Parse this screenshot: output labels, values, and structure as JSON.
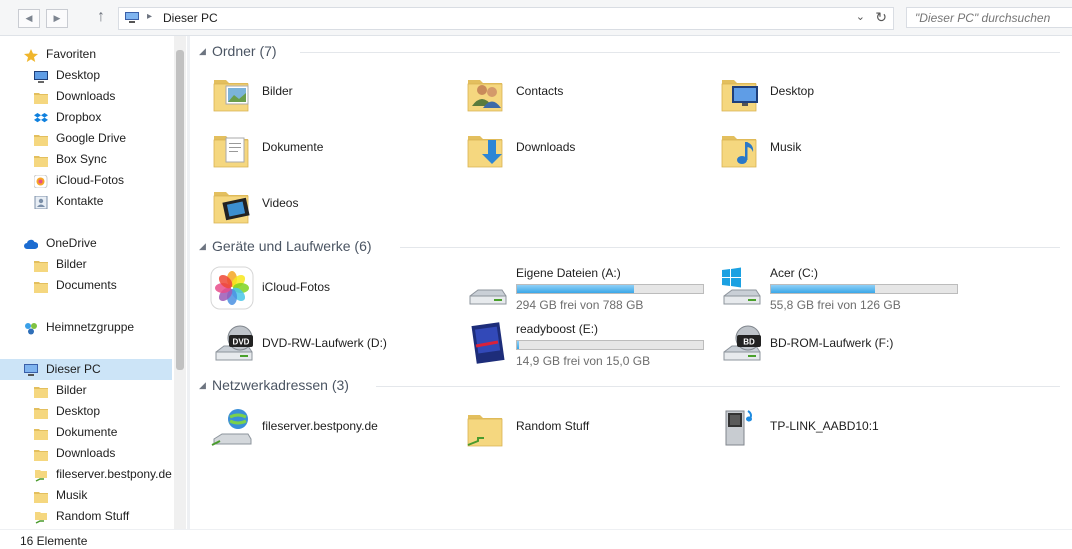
{
  "window": {
    "breadcrumb": "Dieser PC",
    "search_placeholder": "\"Dieser PC\" durchsuchen"
  },
  "nav": [
    {
      "label": "Favoriten",
      "icon": "star-icon",
      "indent": 0
    },
    {
      "label": "Desktop",
      "icon": "desktop-icon",
      "indent": 1
    },
    {
      "label": "Downloads",
      "icon": "folder-icon",
      "indent": 1
    },
    {
      "label": "Dropbox",
      "icon": "dropbox-icon",
      "indent": 1
    },
    {
      "label": "Google Drive",
      "icon": "folder-icon",
      "indent": 1
    },
    {
      "label": "Box Sync",
      "icon": "folder-icon",
      "indent": 1
    },
    {
      "label": "iCloud-Fotos",
      "icon": "photos-icon",
      "indent": 1
    },
    {
      "label": "Kontakte",
      "icon": "contacts-icon",
      "indent": 1
    },
    {
      "label": "OneDrive",
      "icon": "cloud-icon",
      "indent": 0
    },
    {
      "label": "Bilder",
      "icon": "folder-icon",
      "indent": 1
    },
    {
      "label": "Documents",
      "icon": "folder-icon",
      "indent": 1
    },
    {
      "label": "Heimnetzgruppe",
      "icon": "homegroup-icon",
      "indent": 0
    },
    {
      "label": "Dieser PC",
      "icon": "computer-icon",
      "indent": 0,
      "selected": true
    },
    {
      "label": "Bilder",
      "icon": "folder-icon",
      "indent": 1
    },
    {
      "label": "Desktop",
      "icon": "folder-icon",
      "indent": 1
    },
    {
      "label": "Dokumente",
      "icon": "folder-icon",
      "indent": 1
    },
    {
      "label": "Downloads",
      "icon": "folder-icon",
      "indent": 1
    },
    {
      "label": "fileserver.bestpony.de",
      "icon": "network-drive-icon",
      "indent": 1
    },
    {
      "label": "Musik",
      "icon": "folder-icon",
      "indent": 1
    },
    {
      "label": "Random Stuff",
      "icon": "network-drive-icon",
      "indent": 1
    }
  ],
  "groups": {
    "folders": {
      "title": "Ordner (7)",
      "items": [
        {
          "name": "Bilder",
          "icon": "pictures-folder-icon"
        },
        {
          "name": "Contacts",
          "icon": "contacts-folder-icon"
        },
        {
          "name": "Desktop",
          "icon": "desktop-folder-icon"
        },
        {
          "name": "Dokumente",
          "icon": "documents-folder-icon"
        },
        {
          "name": "Downloads",
          "icon": "downloads-folder-icon"
        },
        {
          "name": "Musik",
          "icon": "music-folder-icon"
        },
        {
          "name": "Videos",
          "icon": "videos-folder-icon"
        }
      ]
    },
    "devices": {
      "title": "Geräte und Laufwerke (6)",
      "items": [
        {
          "name": "iCloud-Fotos",
          "icon": "icloud-photos-icon"
        },
        {
          "name": "Eigene Dateien (A:)",
          "icon": "hard-drive-icon",
          "free": "294 GB frei von 788 GB",
          "used_fraction": 0.63
        },
        {
          "name": "Acer (C:)",
          "icon": "windows-drive-icon",
          "free": "55,8 GB frei von 126 GB",
          "used_fraction": 0.56
        },
        {
          "name": "DVD-RW-Laufwerk (D:)",
          "icon": "dvd-drive-icon",
          "badge": "DVD"
        },
        {
          "name": "readyboost (E:)",
          "icon": "readyboost-drive-icon",
          "free": "14,9 GB frei von 15,0 GB",
          "used_fraction": 0.01
        },
        {
          "name": "BD-ROM-Laufwerk (F:)",
          "icon": "bd-drive-icon",
          "badge": "BD"
        }
      ]
    },
    "network": {
      "title": "Netzwerkadressen (3)",
      "items": [
        {
          "name": "fileserver.bestpony.de",
          "icon": "network-location-icon"
        },
        {
          "name": "Random Stuff",
          "icon": "network-folder-icon"
        },
        {
          "name": "TP-LINK_AABD10:1",
          "icon": "media-server-icon"
        }
      ]
    }
  },
  "status": {
    "count": "16 Elemente"
  },
  "colors": {
    "folder": "#f5d77f",
    "selection": "#cce4f7",
    "drive_bar": "#3aa7e8"
  }
}
